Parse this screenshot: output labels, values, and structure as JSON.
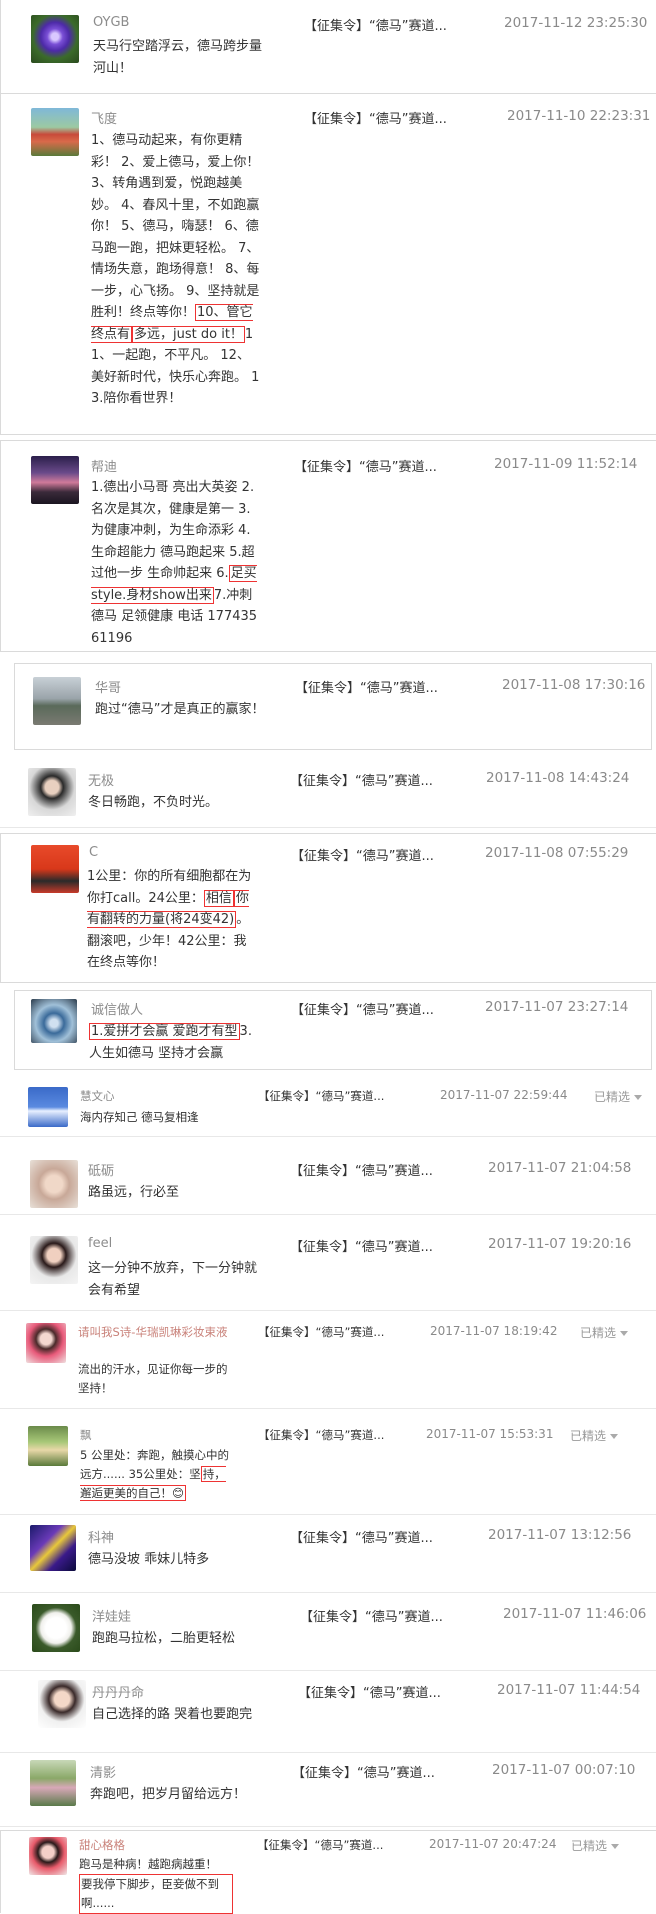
{
  "comments": [
    {
      "user": "OYGB",
      "article": "【征集令】“德马”赛道...",
      "time": "2017-11-12 23:25:30",
      "text": "天马行空踏浮云，德马跨步量河山！"
    },
    {
      "user": "飞度",
      "article": "【征集令】“德马”赛道...",
      "time": "2017-11-10 22:23:31",
      "text_a": "1、德马动起来，有你更精彩！ 2、爱上德马，爱上你！ 3、转角遇到爱，悦跑越美妙。 4、春风十里，不如跑赢你！ 5、德马，嗨瑟！ 6、德马跑一跑，把妹更轻松。 7、情场失意，跑场得意！ 8、每一步，心飞扬。 9、坚持就是胜利！终点等你！",
      "text_hl1": "10、管它终点有",
      "text_hl2": "多远，just do it！",
      "text_b": "11、一起跑，不平凡。 12、美好新时代，快乐心奔跑。 13.陪你看世界！"
    },
    {
      "user": "帮迪",
      "article": "【征集令】“德马”赛道...",
      "time": "2017-11-09 11:52:14",
      "text_a": "1.德出小马哥 亮出大英姿 2.名次是其次，健康是第一 3.为健康冲刺，为生命添彩 4.生命超能力 德马跑起来 5.超过他一步 生命帅起来 6.",
      "text_hl": "足买style.身材show出来",
      "text_b": "7.冲刺德马 足领健康 电话 17743561196"
    },
    {
      "user": "华哥",
      "article": "【征集令】“德马”赛道...",
      "time": "2017-11-08 17:30:16",
      "text": "跑过“德马”才是真正的赢家！"
    },
    {
      "user": "无极",
      "article": "【征集令】“德马”赛道...",
      "time": "2017-11-08 14:43:24",
      "text": "冬日畅跑，不负时光。"
    },
    {
      "user": "C",
      "article": "【征集令】“德马”赛道...",
      "time": "2017-11-08 07:55:29",
      "text_a": "1公里：你的所有细胞都在为你打call。24公里：",
      "text_hl1": "相信",
      "text_hl2": "你有翻转的力量(将24变42)",
      "text_b": "。翻滚吧，少年！42公里：我在终点等你！"
    },
    {
      "user": "诚信做人",
      "article": "【征集令】“德马”赛道...",
      "time": "2017-11-07 23:27:14",
      "text_hl": "1.爱拼才会赢 爱跑才有型",
      "text_b": "3.人生如德马 坚持才会赢"
    },
    {
      "user": "慧文心",
      "article": "【征集令】“德马”赛道...",
      "time": "2017-11-07 22:59:44",
      "featured": "已精选",
      "text": "海内存知己 德马复相逢"
    },
    {
      "user": "砥砺",
      "article": "【征集令】“德马”赛道...",
      "time": "2017-11-07 21:04:58",
      "text": "路虽远，行必至"
    },
    {
      "user": "feel",
      "article": "【征集令】“德马”赛道...",
      "time": "2017-11-07 19:20:16",
      "text": "这一分钟不放弃，下一分钟就会有希望"
    },
    {
      "user": "请叫我S诗-华瑞凯琳彩妆束液",
      "article": "【征集令】“德马”赛道...",
      "time": "2017-11-07 18:19:42",
      "featured": "已精选",
      "text": "流出的汗水，见证你每一步的坚持！"
    },
    {
      "user": "飘",
      "article": "【征集令】“德马”赛道...",
      "time": "2017-11-07 15:53:31",
      "featured": "已精选",
      "text_a": "5 公里处：奔跑，触摸心中的远方...... 35公里处：坚",
      "text_hl": "持，邂逅更美的自己！😊"
    },
    {
      "user": "科神",
      "article": "【征集令】“德马”赛道...",
      "time": "2017-11-07 13:12:56",
      "text": "德马没坡 乖妹儿特多"
    },
    {
      "user": "洋娃娃",
      "article": "【征集令】“德马”赛道...",
      "time": "2017-11-07 11:46:06",
      "text": "跑跑马拉松，二胎更轻松"
    },
    {
      "user": "丹丹丹命",
      "article": "【征集令】“德马”赛道...",
      "time": "2017-11-07 11:44:54",
      "text": "自己选择的路 哭着也要跑完"
    },
    {
      "user": "清影",
      "article": "【征集令】“德马”赛道...",
      "time": "2017-11-07 00:07:10",
      "text": "奔跑吧，把岁月留给远方！"
    },
    {
      "user": "甜心格格",
      "article": "【征集令】“德马”赛道...",
      "time": "2017-11-07 20:47:24",
      "featured": "已精选",
      "text_a": "跑马是种病！越跑病越重！",
      "text_hl": "要我停下脚步，臣妾做不到啊......"
    }
  ],
  "colors": {
    "highlight": "#e33333",
    "username": "#8c8c8c",
    "username_pink": "#c9827a",
    "time": "#8a8a8a"
  }
}
